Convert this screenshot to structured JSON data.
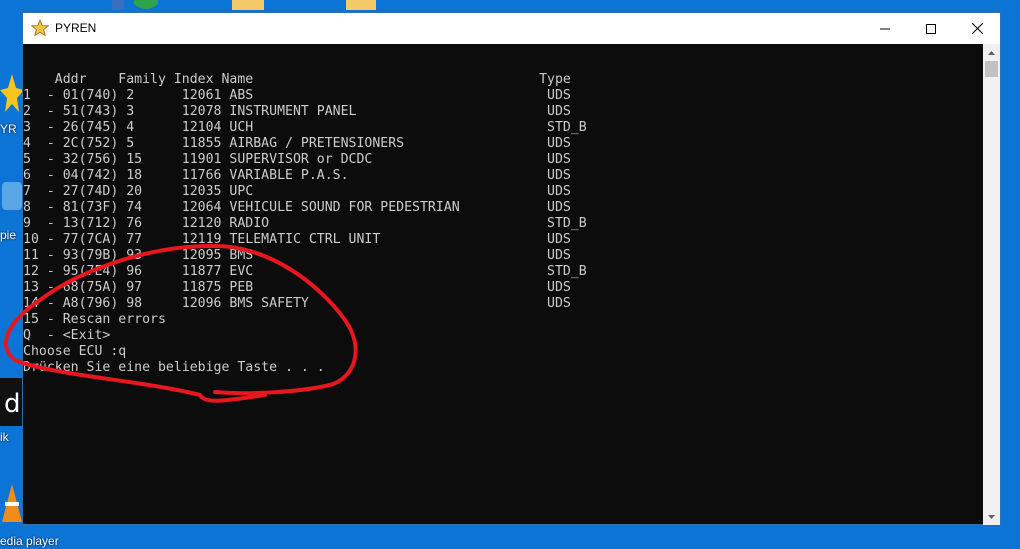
{
  "window": {
    "title": "PYREN",
    "buttons": {
      "minimize": "minimize",
      "maximize": "maximize",
      "close": "close"
    }
  },
  "desktop": {
    "labels": [
      "YR",
      "pie",
      "ik",
      "edia player"
    ]
  },
  "console": {
    "lines": [
      "    Addr    Family Index Name                                    Type",
      "1  - 01(740) 2      12061 ABS                                     UDS",
      "2  - 51(743) 3      12078 INSTRUMENT PANEL                        UDS",
      "3  - 26(745) 4      12104 UCH                                     STD_B",
      "4  - 2C(752) 5      11855 AIRBAG / PRETENSIONERS                  UDS",
      "5  - 32(756) 15     11901 SUPERVISOR or DCDC                      UDS",
      "6  - 04(742) 18     11766 VARIABLE P.A.S.                         UDS",
      "7  - 27(74D) 20     12035 UPC                                     UDS",
      "8  - 81(73F) 74     12064 VEHICULE SOUND FOR PEDESTRIAN           UDS",
      "9  - 13(712) 76     12120 RADIO                                   STD_B",
      "10 - 77(7CA) 77     12119 TELEMATIC CTRL UNIT                     UDS",
      "11 - 93(79B) 93     12095 BMS                                     UDS",
      "12 - 95(7E4) 96     11877 EVC                                     STD_B",
      "13 - 68(75A) 97     11875 PEB                                     UDS",
      "14 - A8(796) 98     12096 BMS SAFETY                              UDS",
      "15 - Rescan errors",
      "Q  - <Exit>",
      "Choose ECU :q",
      "Drücken Sie eine beliebige Taste . . ."
    ]
  },
  "colors": {
    "desktop": "#0b74d4",
    "console_bg": "#0c0c0c",
    "console_text": "#cccccc",
    "annotation": "#e8171f"
  }
}
